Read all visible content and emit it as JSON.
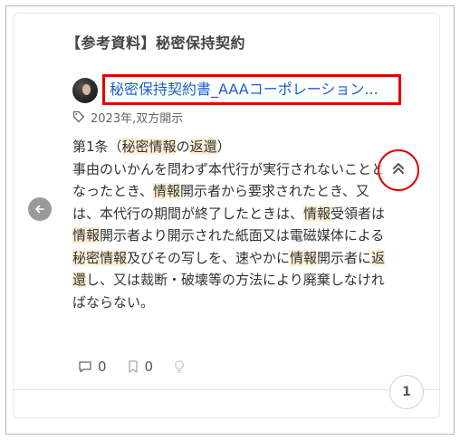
{
  "card": {
    "title": "【参考資料】秘密保持契約",
    "document_link": "秘密保持契約書_AAAコーポレーション...",
    "tags": "2023年,双方開示",
    "body": {
      "segments": [
        {
          "t": "第1条（",
          "h": false
        },
        {
          "t": "秘密情報",
          "h": true
        },
        {
          "t": "の",
          "h": false
        },
        {
          "t": "返還",
          "h": true
        },
        {
          "t": "）",
          "h": false
        },
        {
          "br": true
        },
        {
          "t": "事由のいかんを問わず本代行が実行されないこととなったとき、",
          "h": false
        },
        {
          "t": "情報",
          "h": true
        },
        {
          "t": "開示者から要求されたとき、又は、本代行の期間が終了したときは、",
          "h": false
        },
        {
          "t": "情報",
          "h": true
        },
        {
          "t": "受領者は",
          "h": false
        },
        {
          "t": "情報",
          "h": true
        },
        {
          "t": "開示者より開示された紙面又は電磁媒体による",
          "h": false
        },
        {
          "t": "秘密情報",
          "h": true
        },
        {
          "t": "及びその写しを、速やかに",
          "h": false
        },
        {
          "t": "情報",
          "h": true
        },
        {
          "t": "開示者に",
          "h": false
        },
        {
          "t": "返還",
          "h": true
        },
        {
          "t": "し、又は裁断・破壊等の方法により廃棄しなければならない。",
          "h": false
        }
      ]
    },
    "comment_count": "0",
    "bookmark_count": "0",
    "page_number": "1"
  },
  "colors": {
    "highlight": "#fdf0d5",
    "annotation_red": "#e10000",
    "link_blue": "#1a5fd0"
  },
  "icons": {
    "tag": "tag-icon",
    "collapse": "double-chevron-up-icon",
    "prev": "arrow-left-icon",
    "comment": "comment-icon",
    "bookmark": "bookmark-icon",
    "idea": "lightbulb-icon"
  }
}
